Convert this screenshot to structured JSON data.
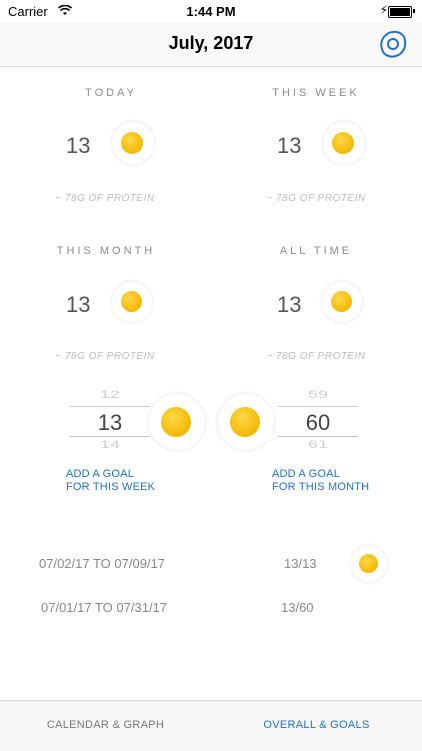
{
  "status_bar": {
    "carrier": "Carrier",
    "time": "1:44 PM"
  },
  "nav": {
    "title": "July, 2017"
  },
  "stats": [
    {
      "heading": "TODAY",
      "count": "13",
      "protein": "~ 78G OF PROTEIN"
    },
    {
      "heading": "THIS WEEK",
      "count": "13",
      "protein": "~ 78G OF PROTEIN"
    },
    {
      "heading": "THIS MONTH",
      "count": "13",
      "protein": "~ 78G OF PROTEIN"
    },
    {
      "heading": "ALL TIME",
      "count": "13",
      "protein": "~ 78G OF PROTEIN"
    }
  ],
  "week_picker": {
    "prev": "12",
    "selected": "13",
    "next": "14"
  },
  "month_picker": {
    "prev": "59",
    "selected": "60",
    "next": "61"
  },
  "goal_links": {
    "week": {
      "line1": "ADD A GOAL",
      "line2": "FOR THIS WEEK"
    },
    "month": {
      "line1": "ADD A GOAL",
      "line2": "FOR THIS MONTH"
    }
  },
  "goal_rows": [
    {
      "range": "07/02/17 TO 07/09/17",
      "progress": "13/13",
      "complete": true
    },
    {
      "range": "07/01/17 TO 07/31/17",
      "progress": "13/60",
      "complete": false
    }
  ],
  "tabs": [
    {
      "label": "CALENDAR & GRAPH",
      "active": false
    },
    {
      "label": "OVERALL & GOALS",
      "active": true
    }
  ],
  "colors": {
    "accent": "#1f6fcf",
    "yolk": "#f5b800"
  },
  "icons": {
    "nav_button": "fried-egg-outline-icon",
    "egg": "fried-egg-icon",
    "wifi": "wifi-icon",
    "battery": "battery-icon"
  }
}
